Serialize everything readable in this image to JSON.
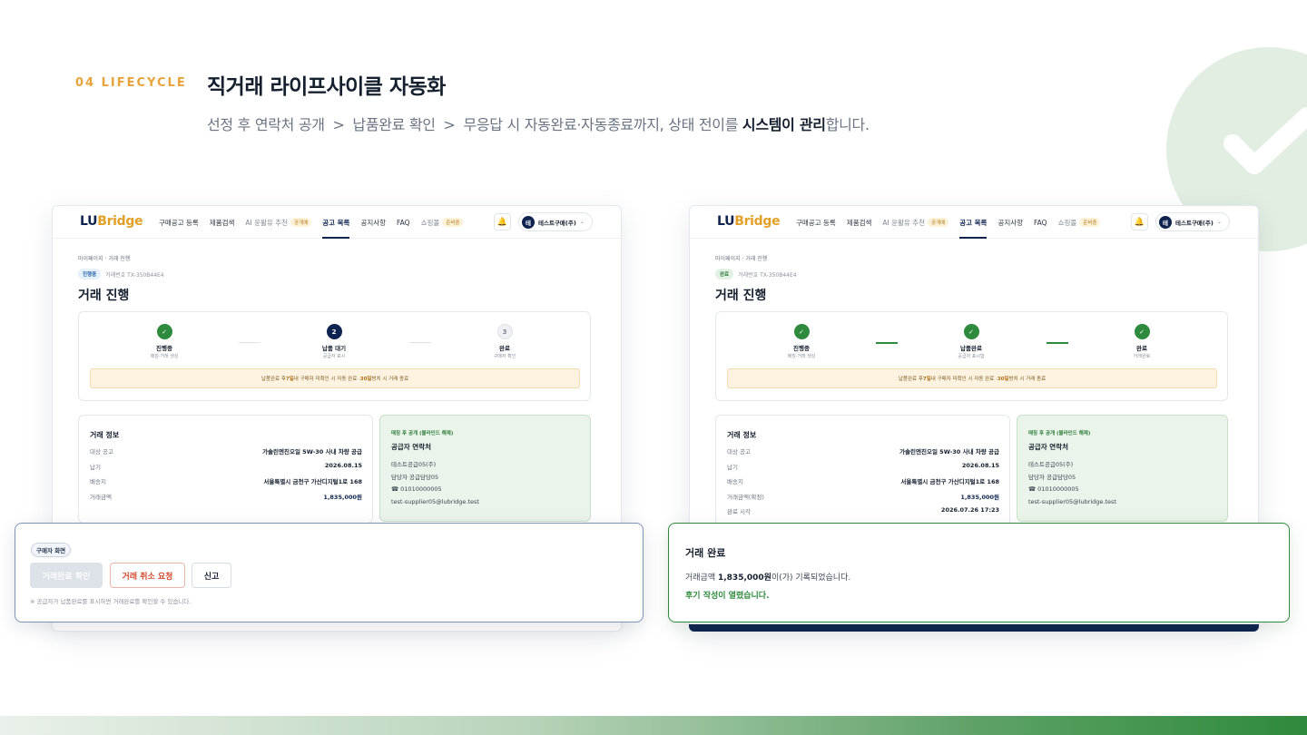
{
  "slide": {
    "eyebrow": "04 LIFECYCLE",
    "headline": "직거래 라이프사이클 자동화",
    "subline": {
      "part1": "선정 후 연락처 공개",
      "sep": ">",
      "part2": "납품완료 확인",
      "part3": "무응답 시 자동완료·자동종료까지, 상태 전이를 ",
      "strong": "시스템이 관리",
      "tail": "합니다."
    },
    "accent_color": "#2e8a3c",
    "deco_icon": "check-icon"
  },
  "app": {
    "logo_lu": "LU",
    "logo_bridge": "Bridge",
    "nav": [
      {
        "label": "구매공고 등록"
      },
      {
        "label": "제품검색"
      },
      {
        "label": "AI 윤활유 추천",
        "tag": "공개예"
      },
      {
        "label": "공고 목록"
      },
      {
        "label": "공지사항"
      },
      {
        "label": "FAQ"
      },
      {
        "label": "쇼핑몰",
        "tag": "준비중"
      }
    ],
    "user_initial": "테",
    "user_name": "테스트구매(주)",
    "breadcrumb": "마이페이지 · 거래 진행",
    "page_title": "거래 진행",
    "info_title": "거래 정보",
    "info_rows": [
      {
        "k": "대상 공고",
        "v": "가솔린엔진오일 5W-30 사내 차량 공급"
      },
      {
        "k": "납기",
        "v": "2026.08.15"
      },
      {
        "k": "배송지",
        "v": "서울특별시 금천구 가산디지털1로 168"
      }
    ],
    "contact": {
      "eyebrow": "매칭 후 공개 (블라인드 해제)",
      "title": "공급자 연락처",
      "company": "테스트공급05(주)",
      "manager": "담당자 공급담당05",
      "phone": "☎ 01010000005",
      "email": "test-supplier05@lubridge.test"
    },
    "notice": {
      "pre": "납품완료 후 ",
      "d1": "7일",
      "mid": " 내 구매자 미확인 시 자동 완료 · ",
      "d2": "30일",
      "post": " 방치 시 거래 종료"
    }
  },
  "left": {
    "status_badge": "진행중",
    "tx_id": "거래번호 TX-350B44E4",
    "steps": [
      {
        "num": "✓",
        "label": "진행중",
        "sub": "매칭·거래 생성",
        "state": "ok"
      },
      {
        "num": "2",
        "label": "납품 대기",
        "sub": "공급자 표시",
        "state": "cur"
      },
      {
        "num": "3",
        "label": "완료",
        "sub": "구매자 확인",
        "state": "todo"
      }
    ],
    "amount_label": "거래금액",
    "amount": "1,835,000원",
    "overlay": {
      "tag": "구매자 화면",
      "btn_confirm": "거래완료 확인",
      "btn_cancel": "거래 취소 요청",
      "btn_report": "신고",
      "note": "※ 공급자가 납품완료를 표시하면 거래완료를 확인할 수 있습니다."
    }
  },
  "right": {
    "status_badge": "완료",
    "tx_id": "거래번호 TX-350B44E4",
    "steps": [
      {
        "num": "✓",
        "label": "진행중",
        "sub": "매칭·거래 생성",
        "state": "ok"
      },
      {
        "num": "✓",
        "label": "납품완료",
        "sub": "공급자 표시함",
        "state": "ok"
      },
      {
        "num": "✓",
        "label": "완료",
        "sub": "거래완료",
        "state": "ok"
      }
    ],
    "amount_label": "거래금액(확정)",
    "amount": "1,835,000원",
    "done_label": "완료 시각",
    "done_at": "2026.07.26 17:23",
    "overlay": {
      "title": "거래 완료",
      "line_pre": "거래금액 ",
      "line_amount": "1,835,000원",
      "line_post": "이(가) 기록되었습니다.",
      "review": "후기 작성이 열렸습니다."
    }
  }
}
